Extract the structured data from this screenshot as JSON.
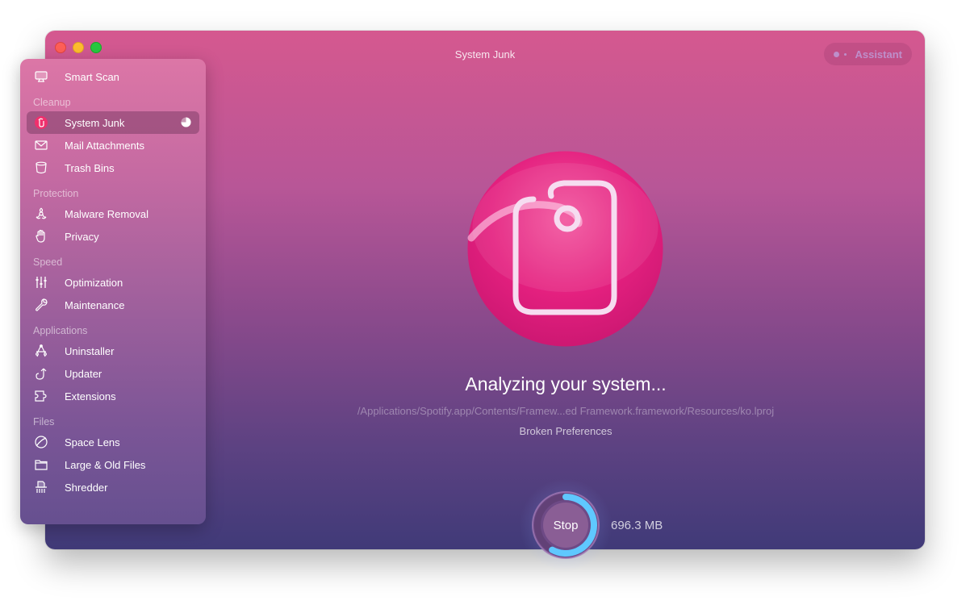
{
  "window": {
    "title": "System Junk",
    "assistant_label": "Assistant"
  },
  "sidebar": {
    "top_item": {
      "label": "Smart Scan",
      "icon": "monitor-icon"
    },
    "sections": [
      {
        "title": "Cleanup",
        "items": [
          {
            "label": "System Junk",
            "icon": "system-junk-icon",
            "active": true
          },
          {
            "label": "Mail Attachments",
            "icon": "envelope-icon"
          },
          {
            "label": "Trash Bins",
            "icon": "trash-bin-icon"
          }
        ]
      },
      {
        "title": "Protection",
        "items": [
          {
            "label": "Malware Removal",
            "icon": "biohazard-icon"
          },
          {
            "label": "Privacy",
            "icon": "hand-icon"
          }
        ]
      },
      {
        "title": "Speed",
        "items": [
          {
            "label": "Optimization",
            "icon": "sliders-icon"
          },
          {
            "label": "Maintenance",
            "icon": "wrench-icon"
          }
        ]
      },
      {
        "title": "Applications",
        "items": [
          {
            "label": "Uninstaller",
            "icon": "uninstaller-icon"
          },
          {
            "label": "Updater",
            "icon": "update-arrow-icon"
          },
          {
            "label": "Extensions",
            "icon": "puzzle-icon"
          }
        ]
      },
      {
        "title": "Files",
        "items": [
          {
            "label": "Space Lens",
            "icon": "lens-icon"
          },
          {
            "label": "Large & Old Files",
            "icon": "folder-icon"
          },
          {
            "label": "Shredder",
            "icon": "shredder-icon"
          }
        ]
      }
    ],
    "active_progress": 0.75
  },
  "main": {
    "status_title": "Analyzing your system...",
    "current_path": "/Applications/Spotify.app/Contents/Framew...ed Framework.framework/Resources/ko.lproj",
    "current_category": "Broken Preferences",
    "stop_label": "Stop",
    "scan_progress": 0.58,
    "found_size": "696.3 MB"
  },
  "colors": {
    "accent_pink": "#e8207f",
    "progress_blue": "#5fc8ff"
  }
}
